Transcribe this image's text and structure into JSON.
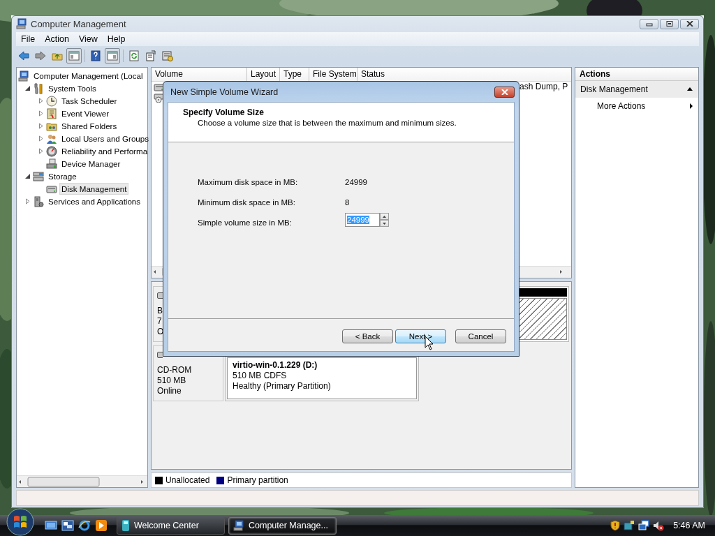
{
  "window": {
    "title": "Computer Management"
  },
  "menu": [
    {
      "label": "File"
    },
    {
      "label": "Action"
    },
    {
      "label": "View"
    },
    {
      "label": "Help"
    }
  ],
  "toolbar": [
    {
      "pressed": false
    },
    {
      "pressed": false
    },
    {
      "pressed": false
    },
    {
      "pressed": true
    },
    {
      "pressed": false
    },
    {
      "pressed": true
    },
    {
      "pressed": false
    },
    {
      "pressed": false
    },
    {
      "pressed": false
    }
  ],
  "tree": [
    {
      "label": "Computer Management (Local",
      "selected": false,
      "children": [
        {
          "label": "System Tools",
          "expanded": true,
          "selected": false,
          "children": [
            {
              "label": "Task Scheduler",
              "expanded": false,
              "selected": false
            },
            {
              "label": "Event Viewer",
              "expanded": false,
              "selected": false
            },
            {
              "label": "Shared Folders",
              "expanded": false,
              "selected": false
            },
            {
              "label": "Local Users and Groups",
              "expanded": false,
              "selected": false
            },
            {
              "label": "Reliability and Performa",
              "expanded": false,
              "selected": false
            },
            {
              "label": "Device Manager",
              "selected": false
            }
          ]
        },
        {
          "label": "Storage",
          "expanded": true,
          "selected": false,
          "children": [
            {
              "label": "Disk Management",
              "selected": true
            }
          ]
        },
        {
          "label": "Services and Applications",
          "expanded": false,
          "selected": false
        }
      ]
    }
  ],
  "volume_list": {
    "columns": [
      "Volume",
      "Layout",
      "Type",
      "File System",
      "Status"
    ],
    "rows": [
      {
        "kind": "volume",
        "status": "ash Dump, P"
      },
      {
        "kind": "cd"
      }
    ]
  },
  "disks": [
    {
      "label_lines": [
        "B",
        "7",
        "O"
      ],
      "partitions": [
        {
          "kind": "unallocated"
        }
      ]
    },
    {
      "label_lines": [
        "CD-ROM",
        "510 MB",
        "Online"
      ],
      "partitions": [
        {
          "kind": "primary",
          "name": "virtio-win-0.1.229  (D:)",
          "lines": [
            "510 MB CDFS",
            "Healthy (Primary Partition)"
          ]
        }
      ]
    }
  ],
  "legend": [
    {
      "label": "Unallocated",
      "color": "#000000"
    },
    {
      "label": "Primary partition",
      "color": "#000080"
    }
  ],
  "actions": {
    "title": "Actions",
    "items": [
      {
        "label": "Disk Management",
        "kind": "section"
      },
      {
        "label": "More Actions",
        "kind": "submenu"
      }
    ]
  },
  "dialog": {
    "title": "New Simple Volume Wizard",
    "heading": "Specify Volume Size",
    "subtitle": "Choose a volume size that is between the maximum and minimum sizes.",
    "fields": [
      {
        "label": "Maximum disk space in MB:",
        "value": "24999",
        "kind": "text"
      },
      {
        "label": "Minimum disk space in MB:",
        "value": "8",
        "kind": "text"
      },
      {
        "label": "Simple volume size in MB:",
        "value": "24999",
        "kind": "spinner",
        "text_selected": true
      }
    ],
    "buttons": [
      {
        "label": "< Back",
        "focused": false
      },
      {
        "label": "Next >",
        "focused": true
      },
      {
        "label": "Cancel",
        "focused": false
      }
    ]
  },
  "taskbar": {
    "windows": [
      {
        "label": "Welcome Center",
        "selected": false
      },
      {
        "label": "Computer Manage...",
        "selected": true
      }
    ],
    "clock": "5:46 AM"
  }
}
